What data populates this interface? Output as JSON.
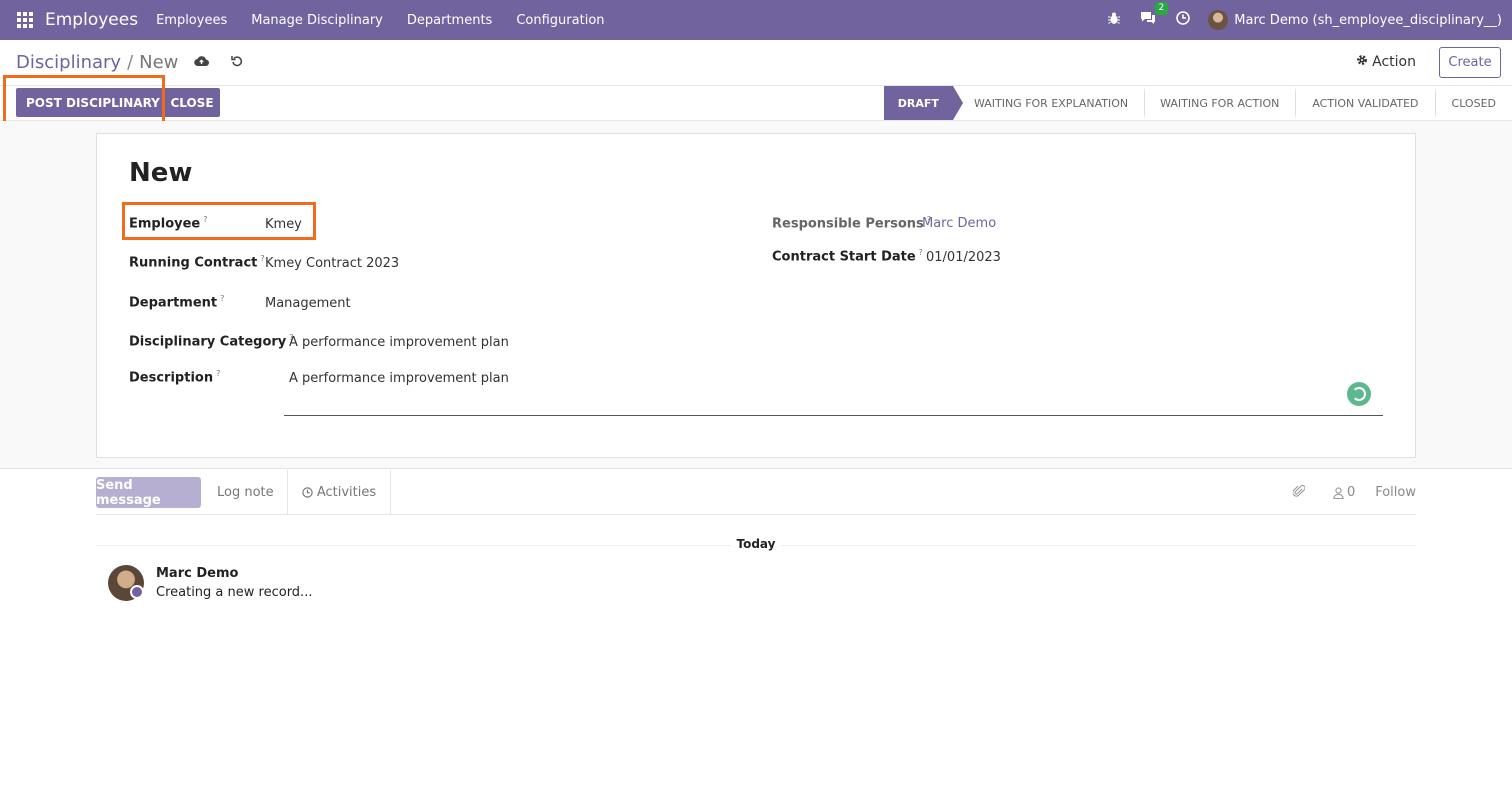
{
  "navbar": {
    "brand": "Employees",
    "menu": [
      "Employees",
      "Manage Disciplinary",
      "Departments",
      "Configuration"
    ],
    "message_count": "2",
    "user_name": "Marc Demo (sh_employee_disciplinary__)"
  },
  "control": {
    "breadcrumb_parent": "Disciplinary",
    "breadcrumb_sep": "/",
    "breadcrumb_current": "New",
    "action_label": "Action",
    "create_label": "Create"
  },
  "statusbar": {
    "post_label": "POST DISCIPLINARY",
    "close_label": "CLOSE",
    "stages": [
      "DRAFT",
      "WAITING FOR EXPLANATION",
      "WAITING FOR ACTION",
      "ACTION VALIDATED",
      "CLOSED"
    ],
    "active_stage": "DRAFT"
  },
  "form": {
    "title": "New",
    "help_mark": "?",
    "employee_label": "Employee",
    "employee_value": "Kmey",
    "contract_label": "Running Contract",
    "contract_value": "Kmey Contract 2023",
    "department_label": "Department",
    "department_value": "Management",
    "category_label": "Disciplinary Category",
    "category_value": "A performance improvement plan",
    "description_label": "Description",
    "description_value": "A performance improvement plan",
    "responsible_label": "Responsible Persons",
    "responsible_value": "Marc Demo",
    "start_date_label": "Contract Start Date",
    "start_date_value": "01/01/2023"
  },
  "chatter": {
    "send_label": "Send message",
    "log_label": "Log note",
    "activities_label": "Activities",
    "follower_count": "0",
    "follow_label": "Follow",
    "today_label": "Today",
    "message_author": "Marc Demo",
    "message_body": "Creating a new record..."
  },
  "colors": {
    "brand": "#71639e",
    "highlight": "#f26b1d"
  }
}
